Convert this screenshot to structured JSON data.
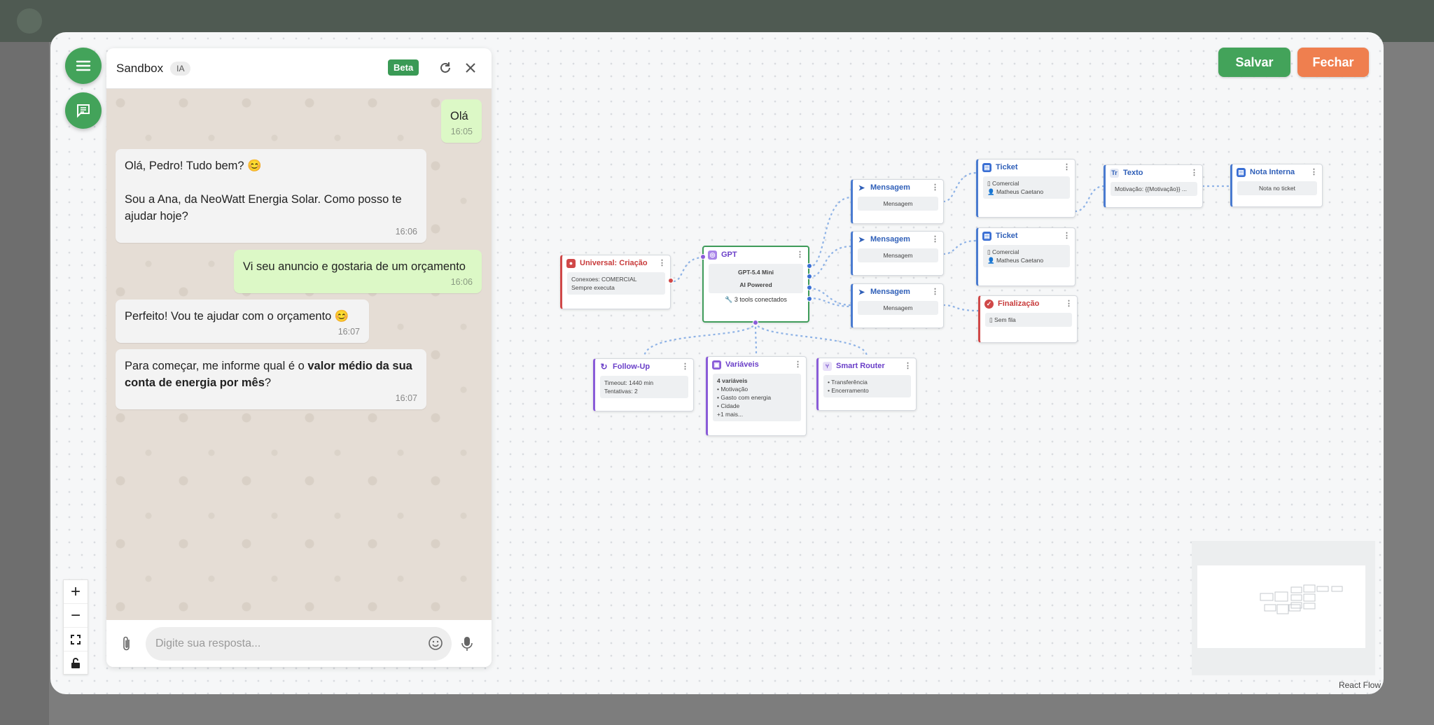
{
  "header": {
    "save_label": "Salvar",
    "close_label": "Fechar"
  },
  "chat": {
    "title": "Sandbox",
    "badge": "IA",
    "beta": "Beta",
    "input_placeholder": "Digite sua resposta...",
    "messages": [
      {
        "dir": "out",
        "text": "Olá",
        "time": "16:05"
      },
      {
        "dir": "in",
        "line1": "Olá, Pedro! Tudo bem? 😊",
        "line2": "Sou a Ana, da NeoWatt Energia Solar. Como posso te ajudar hoje?",
        "time": "16:06"
      },
      {
        "dir": "out",
        "text": "Vi seu anuncio e gostaria de um orçamento",
        "time": "16:06"
      },
      {
        "dir": "in",
        "text": "Perfeito! Vou te ajudar com o orçamento 😊",
        "time": "16:07"
      },
      {
        "dir": "in",
        "pre": "Para começar, me informe qual é o ",
        "bold": "valor médio da sua conta de energia por mês",
        "post": "?",
        "time": "16:07"
      }
    ]
  },
  "flow": {
    "nodes": {
      "universal": {
        "title": "Universal: Criação",
        "line1": "Conexoes: COMERCIAL",
        "line2": "Sempre executa"
      },
      "gpt": {
        "title": "GPT",
        "model": "GPT-5.4 Mini",
        "tag": "AI Powered",
        "tools": "🔧 3 tools conectados"
      },
      "msg1": {
        "title": "Mensagem",
        "body": "Mensagem"
      },
      "msg2": {
        "title": "Mensagem",
        "body": "Mensagem"
      },
      "msg3": {
        "title": "Mensagem",
        "body": "Mensagem"
      },
      "ticket1": {
        "title": "Ticket",
        "line1": "Comercial",
        "line2": "Matheus Caetano"
      },
      "ticket2": {
        "title": "Ticket",
        "line1": "Comercial",
        "line2": "Matheus Caetano"
      },
      "texto": {
        "title": "Texto",
        "body": "Motivação: {{Motivação}} ..."
      },
      "nota": {
        "title": "Nota Interna",
        "body": "Nota no ticket"
      },
      "final": {
        "title": "Finalização",
        "body": "Sem fila"
      },
      "followup": {
        "title": "Follow-Up",
        "line1": "Timeout: 1440 min",
        "line2": "Tentativas: 2"
      },
      "vars": {
        "title": "Variáveis",
        "count": "4 variáveis",
        "items": [
          "• Motivação",
          "• Gasto com energia",
          "• Cidade",
          "+1 mais..."
        ]
      },
      "router": {
        "title": "Smart Router",
        "items": [
          "• Transferência",
          "• Encerramento"
        ]
      }
    }
  },
  "attribution": "React Flow",
  "icons": [
    "menu-icon",
    "chat-icon",
    "refresh-icon",
    "close-icon",
    "attach-icon",
    "emoji-icon",
    "mic-icon",
    "zoom-in-icon",
    "zoom-out-icon",
    "fit-view-icon",
    "lock-icon"
  ],
  "colors": {
    "green": "#43a35a",
    "orange": "#ef7f4f",
    "blue_accent": "#3a6fd4",
    "red_accent": "#d04848",
    "purple_accent": "#8a5cd8"
  }
}
